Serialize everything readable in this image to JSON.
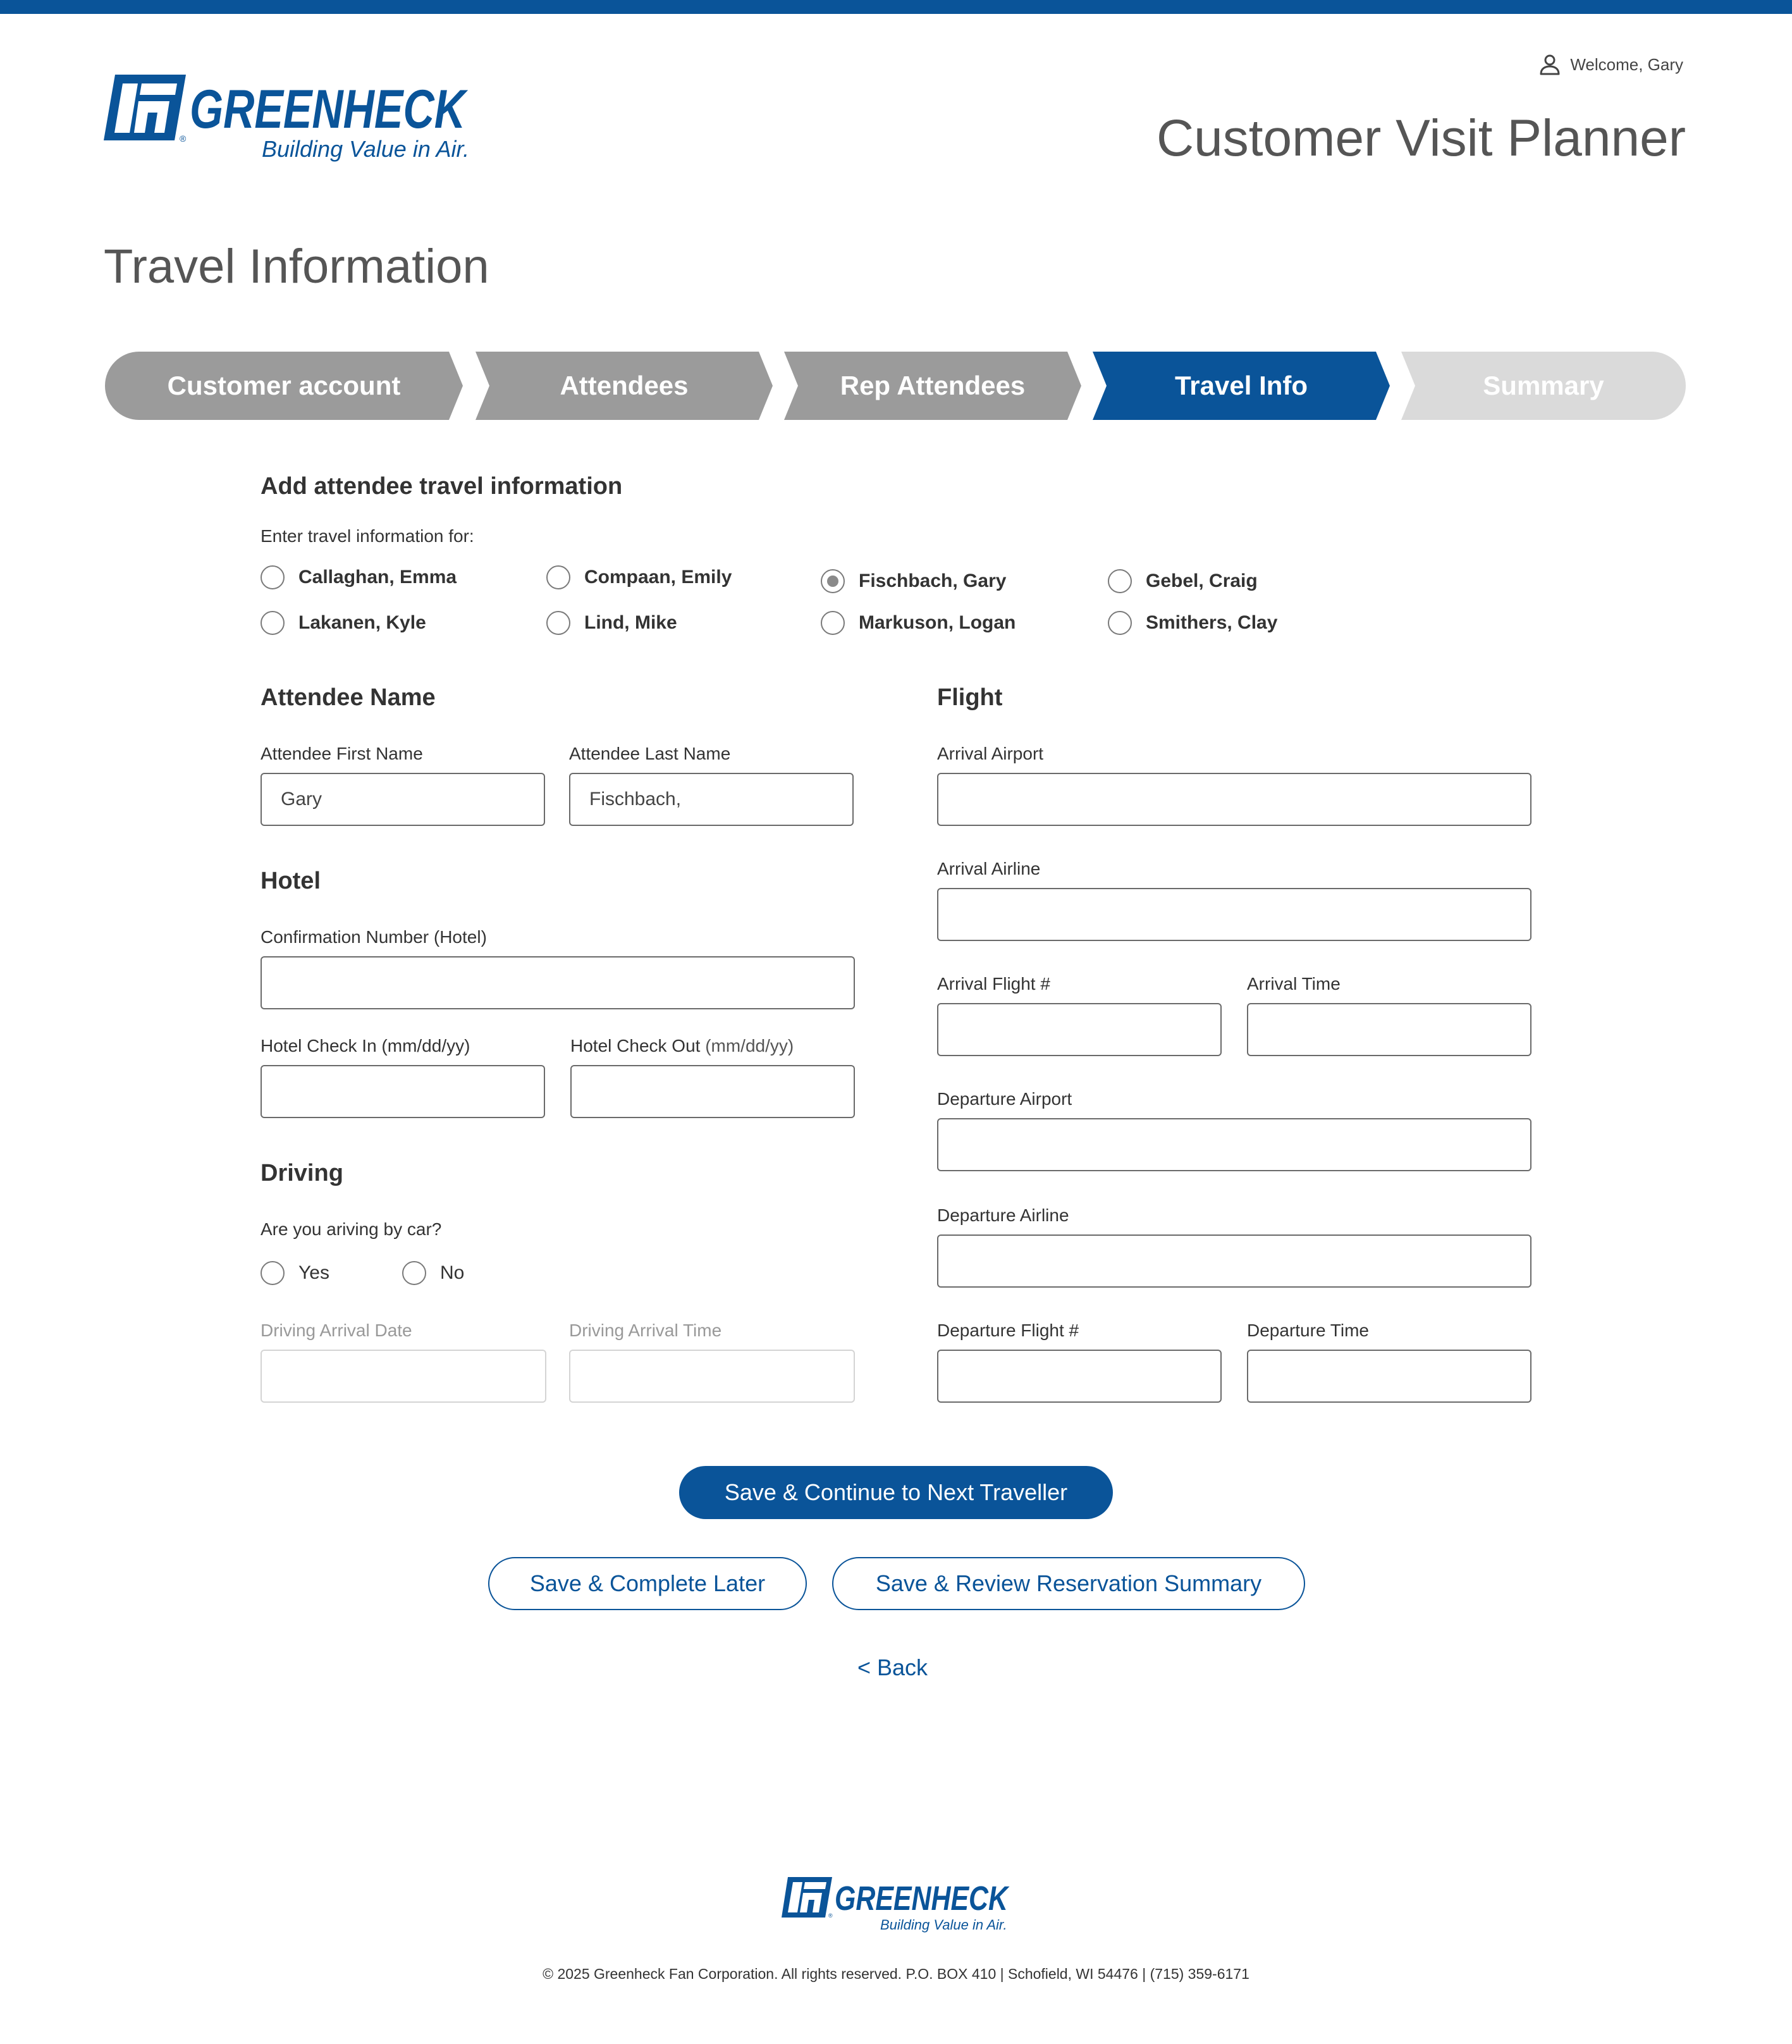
{
  "brand": {
    "name": "GREENHECK",
    "tagline": "Building Value in Air.",
    "registered": "®",
    "color": "#0a5499"
  },
  "header": {
    "welcome": "Welcome, Gary",
    "user_icon": "user-icon",
    "app_title": "Customer Visit Planner"
  },
  "page_title": "Travel Information",
  "stepper": {
    "steps": [
      {
        "label": "Customer account",
        "state": "done"
      },
      {
        "label": "Attendees",
        "state": "done"
      },
      {
        "label": "Rep Attendees",
        "state": "done"
      },
      {
        "label": "Travel Info",
        "state": "active"
      },
      {
        "label": "Summary",
        "state": "todo"
      }
    ]
  },
  "add_travel": {
    "heading": "Add attendee travel information",
    "prompt": "Enter travel information for:",
    "attendees": [
      {
        "name": "Callaghan, Emma",
        "selected": false
      },
      {
        "name": "Compaan, Emily",
        "selected": false
      },
      {
        "name": "Fischbach, Gary",
        "selected": true
      },
      {
        "name": "Gebel, Craig",
        "selected": false
      },
      {
        "name": "Lakanen, Kyle",
        "selected": false
      },
      {
        "name": "Lind, Mike",
        "selected": false
      },
      {
        "name": "Markuson, Logan",
        "selected": false
      },
      {
        "name": "Smithers, Clay",
        "selected": false
      }
    ]
  },
  "attendee_name": {
    "heading": "Attendee Name",
    "first_label": "Attendee First Name",
    "first_value": "Gary",
    "last_label": "Attendee Last Name",
    "last_value": "Fischbach,"
  },
  "hotel": {
    "heading": "Hotel",
    "confirmation_label": "Confirmation Number (Hotel)",
    "confirmation_value": "",
    "checkin_label": "Hotel Check In (mm/dd/yy)",
    "checkin_value": "",
    "checkout_label": "Hotel Check Out",
    "checkout_hint": "(mm/dd/yy)",
    "checkout_value": ""
  },
  "driving": {
    "heading": "Driving",
    "question": "Are you ariving by car?",
    "options": [
      {
        "label": "Yes",
        "selected": false
      },
      {
        "label": "No",
        "selected": false
      }
    ],
    "arrival_date_label": "Driving Arrival Date",
    "arrival_date_value": "",
    "arrival_time_label": "Driving Arrival Time",
    "arrival_time_value": ""
  },
  "flight": {
    "heading": "Flight",
    "arrival_airport_label": "Arrival Airport",
    "arrival_airline_label": "Arrival Airline",
    "arrival_flight_label": "Arrival Flight #",
    "arrival_time_label": "Arrival Time",
    "departure_airport_label": "Departure Airport",
    "departure_airline_label": "Departure Airline",
    "departure_flight_label": "Departure Flight #",
    "departure_time_label": "Departure Time"
  },
  "actions": {
    "continue": "Save & Continue to Next Traveller",
    "complete_later": "Save & Complete Later",
    "review": "Save & Review Reservation Summary",
    "back": "< Back"
  },
  "footer": {
    "text": "© 2025 Greenheck Fan Corporation. All rights reserved.  P.O. BOX 410  |  Schofield, WI 54476  |  (715) 359-6171"
  }
}
